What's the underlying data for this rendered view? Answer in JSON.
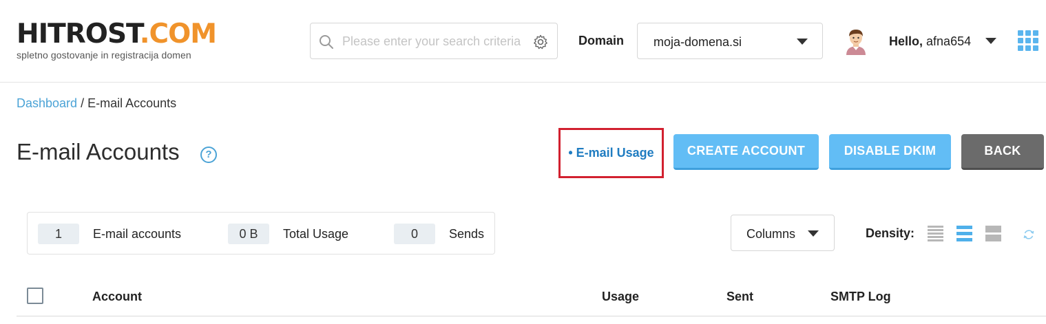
{
  "header": {
    "logo": {
      "main": "HITROST",
      "accent": ".COM",
      "tagline": "spletno gostovanje in registracija domen"
    },
    "search": {
      "placeholder": "Please enter your search criteria"
    },
    "domain": {
      "label": "Domain",
      "selected": "moja-domena.si"
    },
    "user": {
      "greeting": "Hello,",
      "username": "afna654"
    }
  },
  "breadcrumb": {
    "home": "Dashboard",
    "separator": " / ",
    "current": "E-mail Accounts"
  },
  "page": {
    "title": "E-mail Accounts",
    "help": "?",
    "usage_link": "• E-mail Usage",
    "buttons": {
      "create": "CREATE ACCOUNT",
      "dkim": "DISABLE DKIM",
      "back": "BACK"
    }
  },
  "stats": [
    {
      "value": "1",
      "label": "E-mail accounts"
    },
    {
      "value": "0 B",
      "label": "Total Usage"
    },
    {
      "value": "0",
      "label": "Sends"
    }
  ],
  "toolbar": {
    "columns": "Columns",
    "density_label": "Density:",
    "density_selected": "medium"
  },
  "table": {
    "columns": [
      "Account",
      "Usage",
      "Sent",
      "SMTP Log"
    ]
  },
  "colors": {
    "accent": "#4ba3d6",
    "button_blue": "#62bdf5",
    "button_gray": "#6b6b6b",
    "highlight": "#d2202f",
    "logo_accent": "#f0932b"
  }
}
